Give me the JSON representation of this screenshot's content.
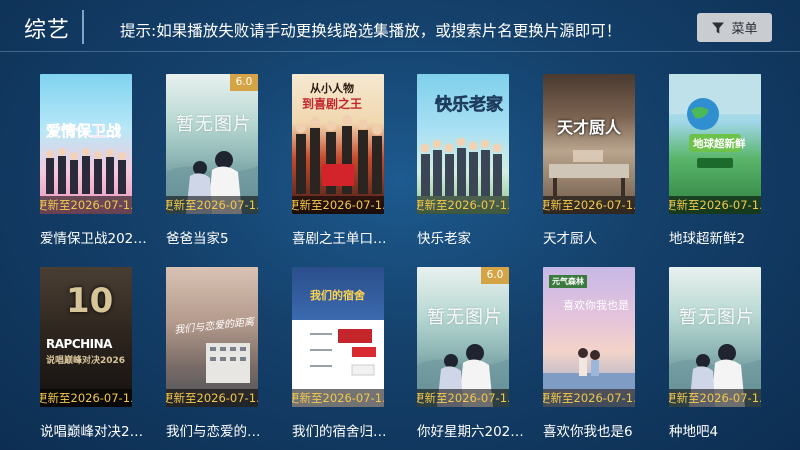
{
  "header": {
    "title": "综艺",
    "hint": "提示:如果播放失败请手动更换线路选集播放，或搜索片名更换片源即可！",
    "menu_label": "菜单",
    "menu_icon": "filter-icon"
  },
  "no_image_text": "暂无图片",
  "update_text": "更新至2026-07-1…",
  "posters": {
    "p1_title": "爱情保卫战",
    "p3_title1": "从小人物",
    "p3_title2": "到喜剧之王",
    "p4_title": "快乐老家",
    "p5_title": "天才厨人",
    "p6_title": "地球超新鲜",
    "p7_title": "说唱巅峰对决2026",
    "p7_big": "10",
    "p7_sub": "RAPCHINA",
    "p8_title": "我们与恋爱的距离",
    "p9_title": "我们的宿舍",
    "p11_title": "喜欢你我也是",
    "p11_logo": "元气森林"
  },
  "row1": [
    {
      "caption": "爱情保卫战202…",
      "score": ""
    },
    {
      "caption": "爸爸当家5",
      "score": "6.0"
    },
    {
      "caption": "喜剧之王单口…",
      "score": ""
    },
    {
      "caption": "快乐老家",
      "score": ""
    },
    {
      "caption": "天才厨人",
      "score": ""
    },
    {
      "caption": "地球超新鲜2",
      "score": ""
    }
  ],
  "row2": [
    {
      "caption": "说唱巅峰对决2…",
      "score": ""
    },
    {
      "caption": "我们与恋爱的…",
      "score": ""
    },
    {
      "caption": "我们的宿舍归…",
      "score": ""
    },
    {
      "caption": "你好星期六202…",
      "score": "6.0"
    },
    {
      "caption": "喜欢你我也是6",
      "score": ""
    },
    {
      "caption": "种地吧4",
      "score": ""
    }
  ],
  "colors": {
    "background": "#14406a",
    "update_text": "#f2c94c",
    "score_badge": "#d29628",
    "menu_button": "#c9ccd1"
  }
}
